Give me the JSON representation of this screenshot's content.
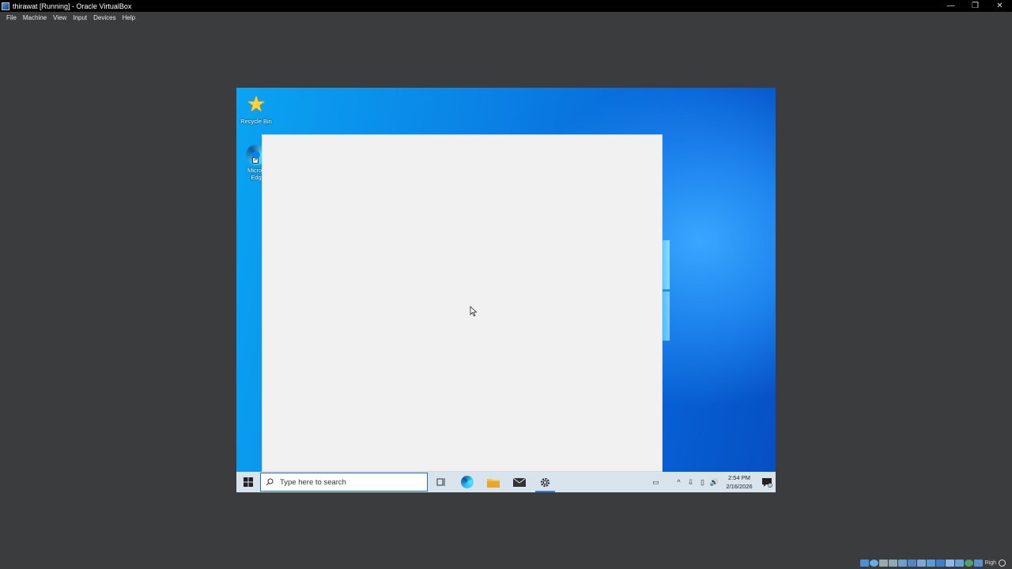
{
  "window": {
    "title": "thirawat [Running] - Oracle VirtualBox",
    "minimize_glyph": "—",
    "restore_glyph": "❐",
    "close_glyph": "✕"
  },
  "menu": [
    "File",
    "Machine",
    "View",
    "Input",
    "Devices",
    "Help"
  ],
  "desktop": {
    "icons": [
      {
        "label": "Recycle Bin",
        "icon": "recycle-bin-icon"
      },
      {
        "label": "Micros\nEdg",
        "icon": "microsoft-edge-icon"
      }
    ]
  },
  "taskbar": {
    "search_placeholder": "Type here to search",
    "pinned": [
      "task-view-icon",
      "edge-icon",
      "file-explorer-icon",
      "mail-icon",
      "settings-icon"
    ],
    "active_app": "settings-icon",
    "tray_glyphs": [
      "▭",
      "^",
      "⇩",
      "▯",
      "🔊"
    ],
    "time": "2:54 PM",
    "date": "2/16/2026",
    "notification_count": "1"
  },
  "statusbar": {
    "host_key": "Righ",
    "colors": [
      "#4a8fd8",
      "#5fb0e8",
      "#9aa",
      "#8ab",
      "#6a9fd0",
      "#4e86c8",
      "#7aa8d8",
      "#5c9ad6",
      "#3f7fc6",
      "#8bb8e8",
      "#6aa0d8",
      "#4fa070",
      "#5a8fd0",
      "#7ab"
    ]
  },
  "colors": {
    "vbox_bg": "#3a3c3e",
    "desktop_blue": "#0a83e6",
    "window_bg": "#f1f1f1",
    "taskbar": "#d8e3ec"
  }
}
